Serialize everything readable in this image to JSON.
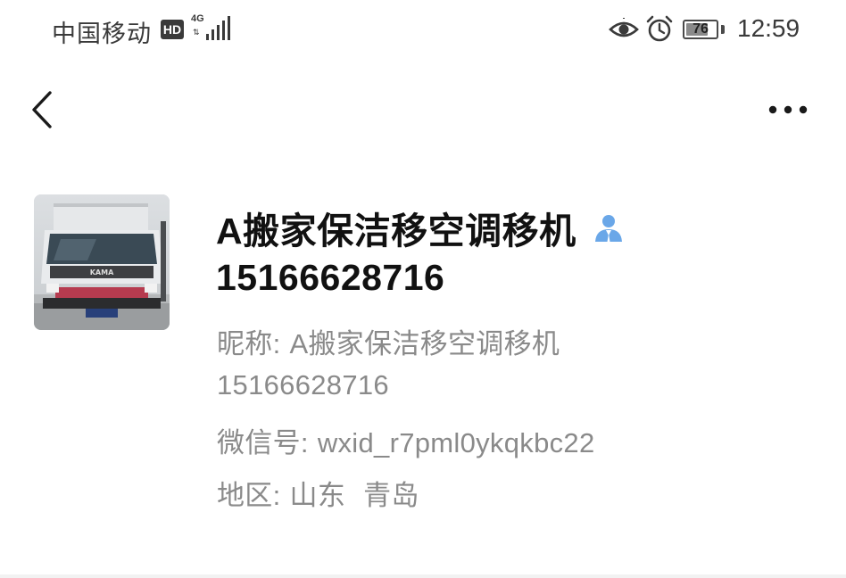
{
  "status_bar": {
    "carrier": "中国移动",
    "hd_badge": "HD",
    "network_type": "4G",
    "signal_strength_bars": 5,
    "battery_level": "76",
    "battery_fraction": 0.76,
    "time": "12:59"
  },
  "nav": {
    "back_icon": "chevron-left-icon",
    "more_icon": "more-horizontal-icon"
  },
  "profile": {
    "avatar_description": "truck photo",
    "display_name": "A搬家保洁移空调移机",
    "contact_type_icon": "person-icon",
    "contact_type_icon_color": "#6aa7e8",
    "remark_phone": "15166628716",
    "nickname_label": "昵称:",
    "nickname_value": "A搬家保洁移空调移机",
    "phone_line": "15166628716",
    "wechat_id_label": "微信号:",
    "wechat_id_value": "wxid_r7pml0ykqkbc22",
    "region_label": "地区:",
    "region_province": "山东",
    "region_city": "青岛"
  },
  "colors": {
    "primary_text": "#111111",
    "secondary_text": "#8a8a8a",
    "status_text": "#3a3a3a",
    "background": "#ffffff"
  }
}
